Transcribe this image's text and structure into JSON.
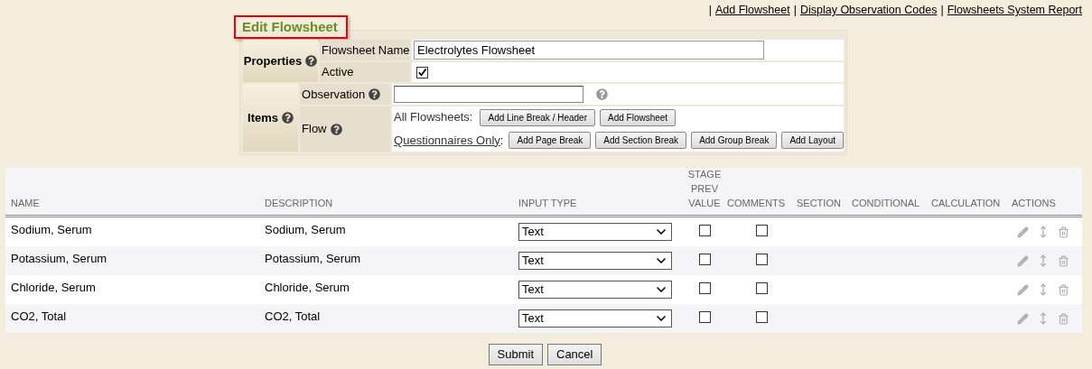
{
  "top_links": [
    {
      "sep": "|",
      "label": "Add Flowsheet"
    },
    {
      "sep": "|",
      "label": "Display Observation Codes"
    },
    {
      "sep": "|",
      "label": "Flowsheets System Report"
    }
  ],
  "form": {
    "title": "Edit Flowsheet",
    "properties": {
      "label": "Properties",
      "name_label": "Flowsheet Name",
      "name_value": "Electrolytes Flowsheet",
      "active_label": "Active",
      "active_checked": true
    },
    "items": {
      "label": "Items",
      "observation_label": "Observation",
      "flow_label": "Flow",
      "all_label": "All Flowsheets:",
      "all_buttons": [
        "Add Line Break / Header",
        "Add Flowsheet"
      ],
      "questionnaires_link": "Questionnaires Only",
      "questionnaires_colon": ":",
      "questionnaire_buttons": [
        "Add Page Break",
        "Add Section Break",
        "Add Group Break",
        "Add Layout"
      ]
    }
  },
  "table": {
    "columns": [
      "NAME",
      "DESCRIPTION",
      "INPUT TYPE",
      "STAGE PREV VALUE",
      "COMMENTS",
      "SECTION",
      "CONDITIONAL",
      "CALCULATION",
      "ACTIONS"
    ],
    "rows": [
      {
        "name": "Sodium, Serum",
        "description": "Sodium, Serum",
        "input_type": "Text",
        "stage_prev_value": false,
        "comments": false
      },
      {
        "name": "Potassium, Serum",
        "description": "Potassium, Serum",
        "input_type": "Text",
        "stage_prev_value": false,
        "comments": false
      },
      {
        "name": "Chloride, Serum",
        "description": "Chloride, Serum",
        "input_type": "Text",
        "stage_prev_value": false,
        "comments": false
      },
      {
        "name": "CO2, Total",
        "description": "CO2, Total",
        "input_type": "Text",
        "stage_prev_value": false,
        "comments": false
      }
    ]
  },
  "buttons": [
    "Submit",
    "Cancel"
  ]
}
